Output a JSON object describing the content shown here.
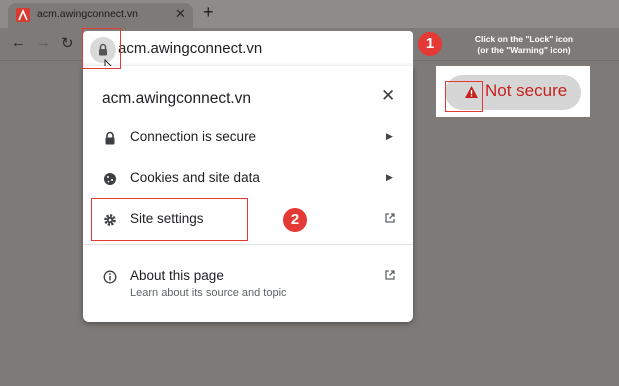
{
  "tab": {
    "title": "acm.awingconnect.vn",
    "close_label": "✕",
    "new_tab_label": "+"
  },
  "toolbar": {
    "back_label": "←",
    "forward_label": "→",
    "reload_label": "↻"
  },
  "address": {
    "url": "acm.awingconnect.vn"
  },
  "popup": {
    "title": "acm.awingconnect.vn",
    "close_label": "✕",
    "rows": [
      {
        "label": "Connection is secure",
        "icon": "lock-icon",
        "arrow": "▶"
      },
      {
        "label": "Cookies and site data",
        "icon": "cookie-icon",
        "arrow": "▶"
      },
      {
        "label": "Site settings",
        "icon": "gear-icon"
      },
      {
        "label": "About this page",
        "sub": "Learn about its source and topic",
        "icon": "info-icon"
      }
    ]
  },
  "annotations": {
    "step1": "1",
    "step2": "2",
    "note_line1": "Click on the \"Lock\" icon",
    "note_line2": "(or the \"Warning\" icon)",
    "not_secure": "Not secure",
    "accent": "#e53935"
  }
}
